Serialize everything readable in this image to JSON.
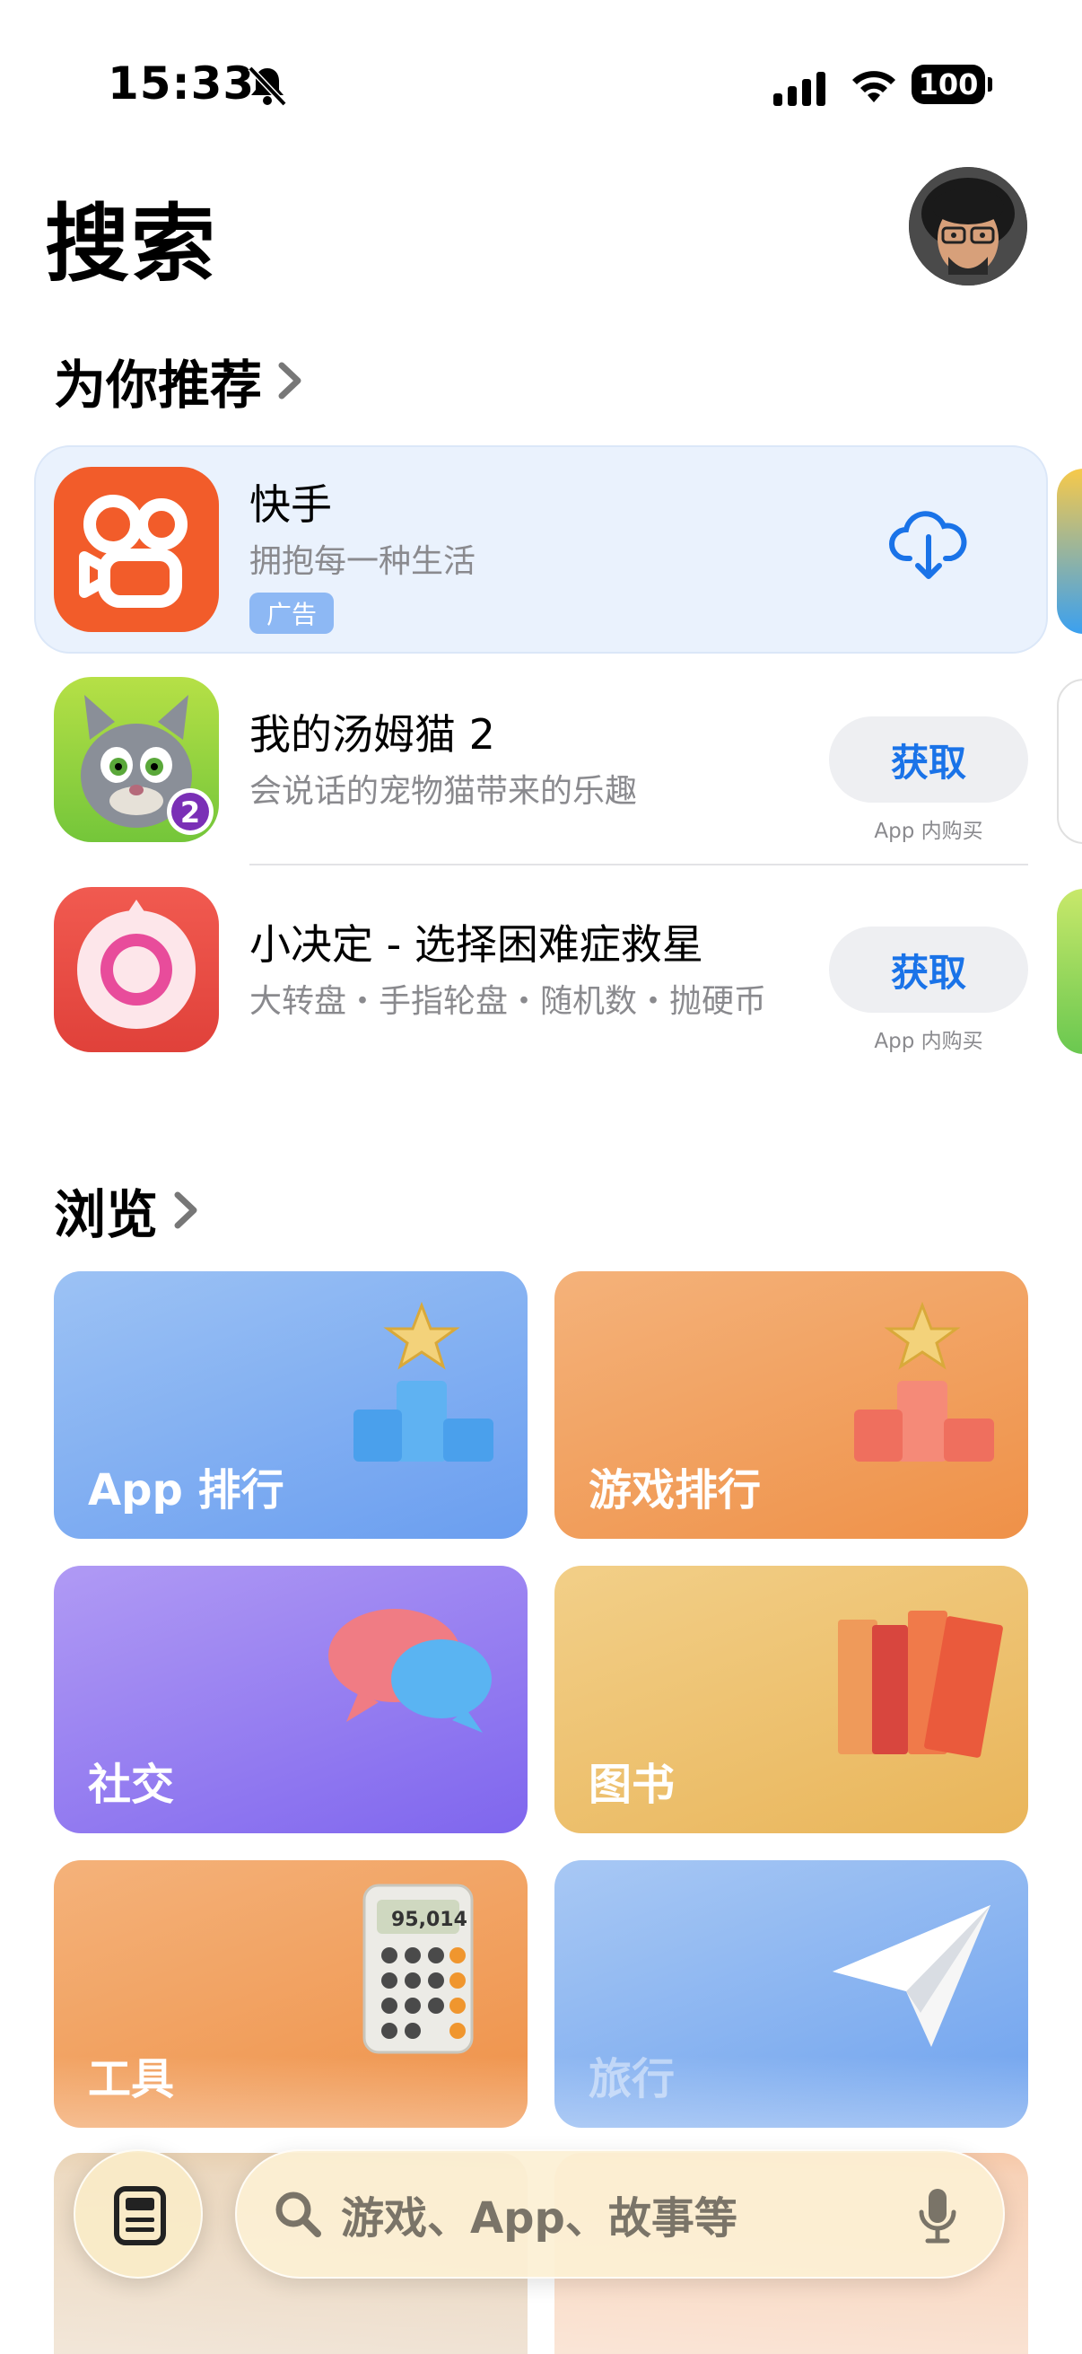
{
  "status_bar": {
    "time": "15:33",
    "battery": "100"
  },
  "header": {
    "title": "搜索"
  },
  "recommend": {
    "title": "为你推荐",
    "apps": [
      {
        "name": "快手",
        "subtitle": "拥抱每一种生活",
        "badge": "广告",
        "action": "download"
      },
      {
        "name": "我的汤姆猫 2",
        "subtitle": "会说话的宠物猫带来的乐趣",
        "button": "获取",
        "iap": "App 内购买"
      },
      {
        "name": "小决定 - 选择困难症救星",
        "subtitle": "大转盘・手指轮盘・随机数・抛硬币",
        "button": "获取",
        "iap": "App 内购买"
      }
    ]
  },
  "browse": {
    "title": "浏览",
    "tiles": [
      {
        "label": "App 排行"
      },
      {
        "label": "游戏排行"
      },
      {
        "label": "社交"
      },
      {
        "label": "图书"
      },
      {
        "label": "工具"
      },
      {
        "label": "旅行"
      }
    ],
    "calculator_display": "95,014"
  },
  "search": {
    "placeholder": "游戏、App、故事等"
  },
  "colors": {
    "accent": "#1a73e8",
    "ad_card": "#eaf2fd",
    "kuaishou": "#f25c2a"
  }
}
